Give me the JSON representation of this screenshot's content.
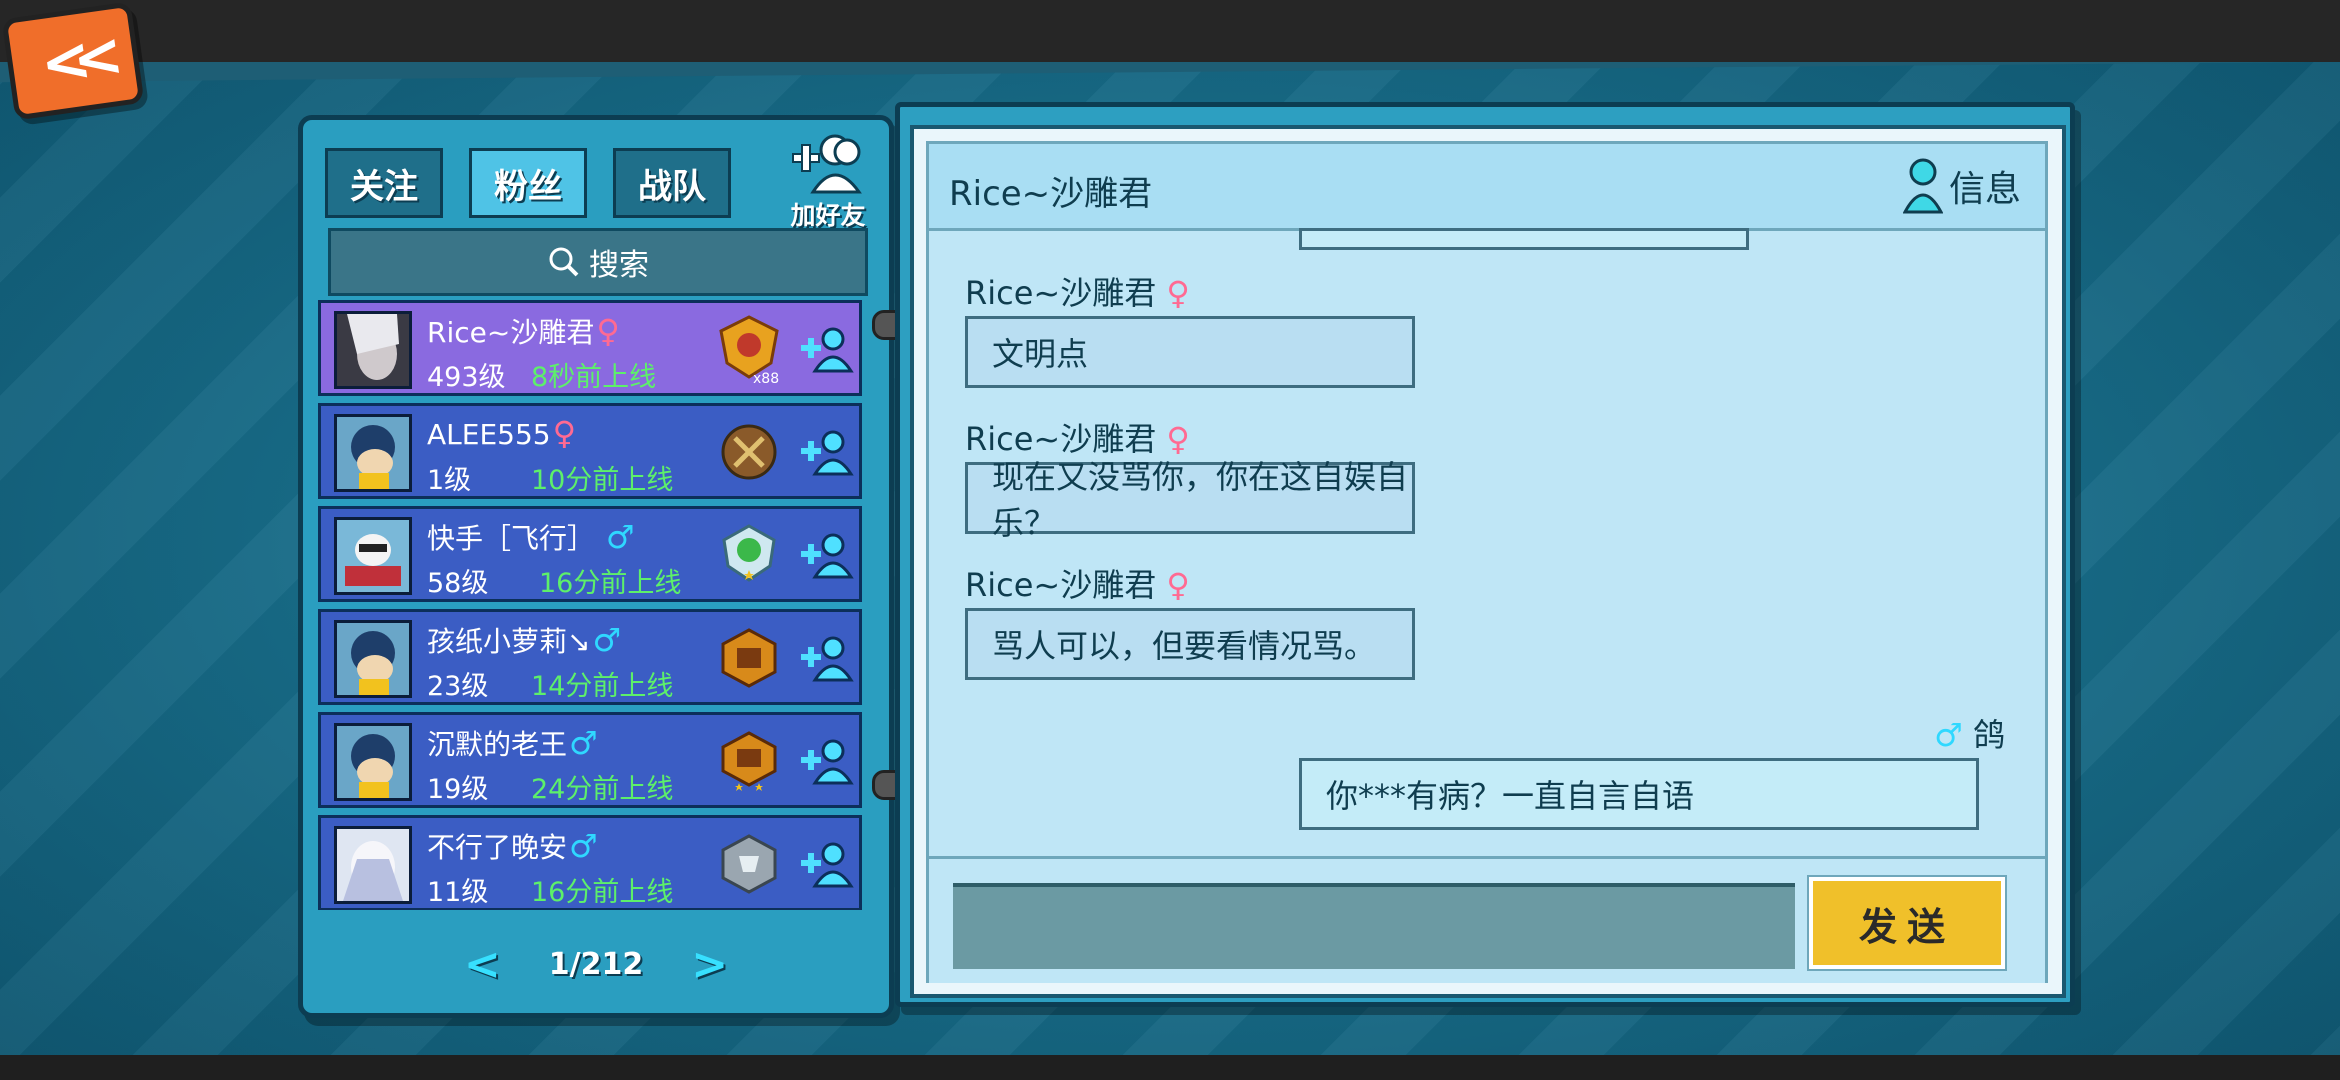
{
  "tabs": [
    {
      "label": "关注",
      "active": false
    },
    {
      "label": "粉丝",
      "active": true
    },
    {
      "label": "战队",
      "active": false
    }
  ],
  "add_friend_label": "加好友",
  "search_label": "搜索",
  "friends": [
    {
      "name": "Rice~沙雕君",
      "gender": "♀",
      "level": "493级",
      "status": "8秒前上线",
      "rank_extra": "x88",
      "selected": true
    },
    {
      "name": "ALEE555",
      "gender": "♀",
      "level": "1级",
      "status": "10分前上线",
      "selected": false
    },
    {
      "name": "快手［飞行］",
      "gender": "♂",
      "level": "58级",
      "status": "16分前上线",
      "selected": false
    },
    {
      "name": "孩纸小萝莉↘",
      "gender": "♂",
      "level": "23级",
      "status": "14分前上线",
      "selected": false
    },
    {
      "name": "沉默的老王",
      "gender": "♂",
      "level": "19级",
      "status": "24分前上线",
      "selected": false
    },
    {
      "name": "不行了晚安",
      "gender": "♂",
      "level": "11级",
      "status": "16分前上线",
      "selected": false
    }
  ],
  "pager": {
    "text": "1/212"
  },
  "chat": {
    "title": "Rice~沙雕君",
    "info_label": "信息",
    "messages": [
      {
        "sender": "Rice~沙雕君",
        "gender": "♀",
        "text": "文明点"
      },
      {
        "sender": "Rice~沙雕君",
        "gender": "♀",
        "text": "现在又没骂你，你在这自娱自乐？"
      },
      {
        "sender": "Rice~沙雕君",
        "gender": "♀",
        "text": "骂人可以，但要看情况骂。"
      },
      {
        "sender": "鸽",
        "gender": "♂",
        "text": "你***有病？一直自言自语",
        "mine": true
      }
    ],
    "input_placeholder": "",
    "send_label": "发送"
  },
  "colors": {
    "female": "#ff6a92",
    "male": "#2fd8ff",
    "online": "#5df06a",
    "send": "#f0c02a"
  }
}
